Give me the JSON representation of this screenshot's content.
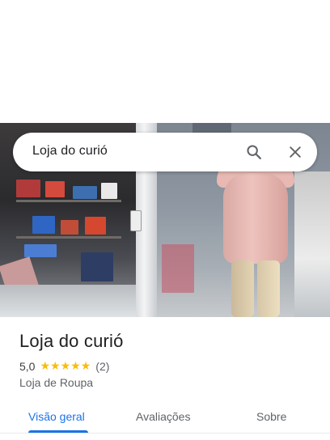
{
  "search": {
    "query": "Loja do curió",
    "search_icon": "search-icon",
    "close_icon": "close-icon"
  },
  "place": {
    "title": "Loja do curió",
    "rating_text": "5,0",
    "rating": 5.0,
    "stars_max": 5,
    "review_count_text": "(2)",
    "category": "Loja de Roupa"
  },
  "tabs": [
    {
      "label": "Visão geral",
      "active": true
    },
    {
      "label": "Avaliações",
      "active": false
    },
    {
      "label": "Sobre",
      "active": false
    }
  ],
  "colors": {
    "accent": "#1a73e8",
    "star": "#fbbc04",
    "text_primary": "#202124",
    "text_secondary": "#5f6368"
  }
}
